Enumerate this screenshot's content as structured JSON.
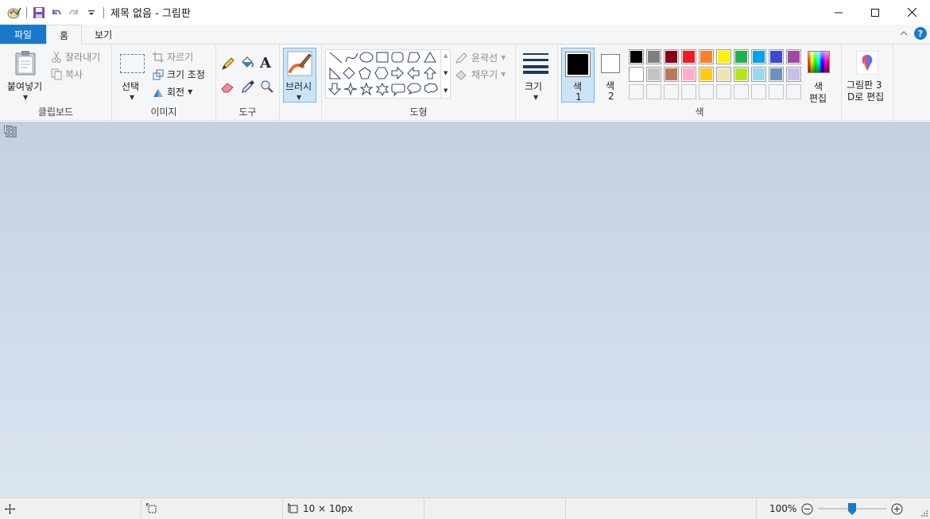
{
  "window": {
    "title": "제목 없음 - 그림판"
  },
  "tabs": {
    "file": "파일",
    "home": "홈",
    "view": "보기"
  },
  "clipboard": {
    "paste": "붙여넣기",
    "cut": "잘라내기",
    "copy": "복사",
    "group": "클립보드"
  },
  "image": {
    "select": "선택",
    "crop": "자르기",
    "resize": "크기 조정",
    "rotate": "회전",
    "group": "이미지"
  },
  "tools": {
    "group": "도구",
    "text_glyph": "A"
  },
  "brushes": {
    "label": "브러시"
  },
  "shapes": {
    "outline": "윤곽선",
    "fill": "채우기",
    "group": "도형"
  },
  "size": {
    "label": "크기"
  },
  "colors": {
    "color1": "색",
    "color1_num": "1",
    "color2": "색",
    "color2_num": "2",
    "edit_line1": "색",
    "edit_line2": "편집",
    "group": "색",
    "color1_value": "#000000",
    "color2_value": "#ffffff",
    "palette_row1": [
      "#000000",
      "#7f7f7f",
      "#880015",
      "#ed1c24",
      "#ff7f27",
      "#fff200",
      "#22b14c",
      "#00a2e8",
      "#3f48cc",
      "#a349a4"
    ],
    "palette_row2": [
      "#ffffff",
      "#c3c3c3",
      "#b97a57",
      "#ffaec9",
      "#ffc90e",
      "#efe4b0",
      "#b5e61d",
      "#99d9ea",
      "#7092be",
      "#c8bfe7"
    ],
    "palette_row3": [
      "",
      "",
      "",
      "",
      "",
      "",
      "",
      "",
      "",
      ""
    ]
  },
  "paint3d": {
    "line1": "그림판 3",
    "line2": "D로 편집"
  },
  "status": {
    "canvas_size": "10 × 10px",
    "zoom": "100%",
    "zoom_level_percent": 100
  }
}
